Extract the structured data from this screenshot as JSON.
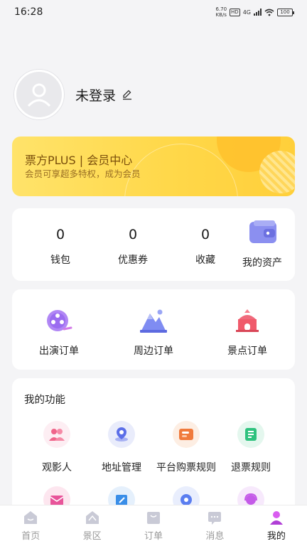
{
  "status_bar": {
    "time": "16:28",
    "net_speed_value": "6.70",
    "net_speed_unit": "KB/s",
    "hd": "HD",
    "network": "4G",
    "battery": "100"
  },
  "profile": {
    "username": "未登录"
  },
  "vip": {
    "title": "票方PLUS | 会员中心",
    "subtitle": "会员可享超多特权，成为会员"
  },
  "assets": {
    "items": [
      {
        "value": "0",
        "label": "钱包"
      },
      {
        "value": "0",
        "label": "优惠券"
      },
      {
        "value": "0",
        "label": "收藏"
      }
    ],
    "my_assets_label": "我的资产"
  },
  "orders": {
    "items": [
      {
        "label": "出演订单",
        "icon": "film-reel-icon",
        "color": "#9b6cf0"
      },
      {
        "label": "周边订单",
        "icon": "mountain-icon",
        "color": "#6b7cf0"
      },
      {
        "label": "景点订单",
        "icon": "temple-icon",
        "color": "#f05a6b"
      }
    ]
  },
  "functions": {
    "title": "我的功能",
    "items": [
      {
        "label": "观影人",
        "icon": "people-icon",
        "color": "#f0648a"
      },
      {
        "label": "地址管理",
        "icon": "location-icon",
        "color": "#5b6ee8"
      },
      {
        "label": "平台购票规则",
        "icon": "ticket-icon",
        "color": "#f07a3c"
      },
      {
        "label": "退票规则",
        "icon": "document-icon",
        "color": "#2ec27e"
      },
      {
        "label": "",
        "icon": "mail-icon",
        "color": "#e8549a"
      },
      {
        "label": "",
        "icon": "edit-note-icon",
        "color": "#3a8ee8"
      },
      {
        "label": "",
        "icon": "gear-icon",
        "color": "#5b7ef0"
      },
      {
        "label": "",
        "icon": "support-icon",
        "color": "#c45ae8"
      }
    ]
  },
  "tabs": [
    {
      "label": "首页",
      "icon": "home-icon",
      "active": false
    },
    {
      "label": "景区",
      "icon": "scenic-icon",
      "active": false
    },
    {
      "label": "订单",
      "icon": "order-icon",
      "active": false
    },
    {
      "label": "消息",
      "icon": "message-icon",
      "active": false
    },
    {
      "label": "我的",
      "icon": "profile-icon",
      "active": true
    }
  ],
  "colors": {
    "accent": "#c04fd8",
    "vip_text": "#7a4e0b",
    "background": "#f4f4f6"
  }
}
